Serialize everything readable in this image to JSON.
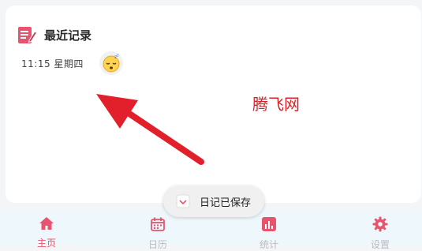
{
  "recent": {
    "title": "最近记录",
    "entry_time": "11:15 星期四",
    "mood_icon": "sleeping-face"
  },
  "watermark": "腾飞网",
  "toast": {
    "text": "日记已保存"
  },
  "tabs": [
    {
      "label": "主页",
      "icon": "home-icon",
      "active": true
    },
    {
      "label": "日历",
      "icon": "calendar-icon",
      "active": false
    },
    {
      "label": "统计",
      "icon": "chart-icon",
      "active": false
    },
    {
      "label": "设置",
      "icon": "gear-icon",
      "active": false
    }
  ],
  "colors": {
    "accent": "#e8536d",
    "annotation_arrow": "#e2202b"
  }
}
